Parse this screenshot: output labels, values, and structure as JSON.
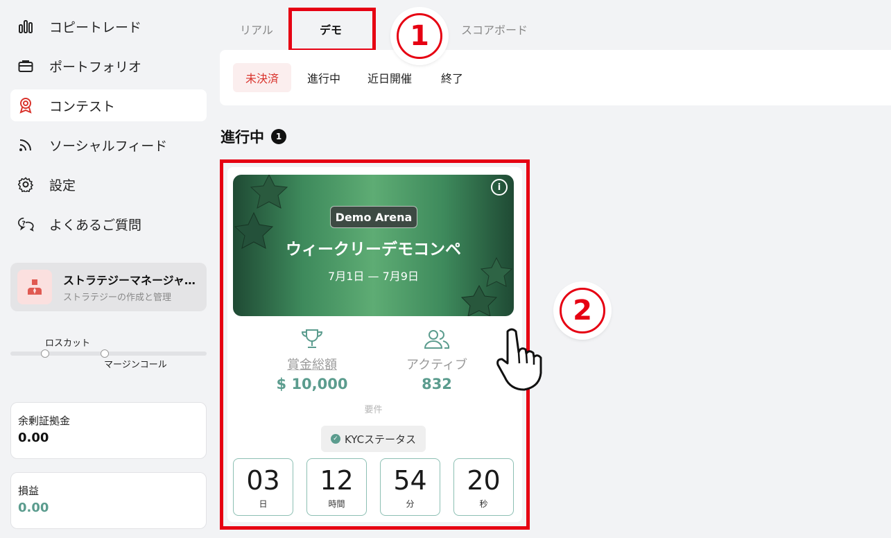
{
  "sidebar": {
    "items": [
      {
        "label": "コピートレード",
        "icon": "bar-chart-icon"
      },
      {
        "label": "ポートフォリオ",
        "icon": "briefcase-icon"
      },
      {
        "label": "コンテスト",
        "icon": "award-ribbon-icon",
        "active": true
      },
      {
        "label": "ソーシャルフィード",
        "icon": "rss-feed-icon"
      },
      {
        "label": "設定",
        "icon": "gear-icon"
      },
      {
        "label": "よくあるご質問",
        "icon": "chat-question-icon"
      }
    ],
    "strategy": {
      "title": "ストラテジーマネージャ…",
      "subtitle": "ストラテジーの作成と管理"
    },
    "slider": {
      "stop_loss_label": "ロスカット",
      "margin_call_label": "マージンコール"
    },
    "free_margin": {
      "label": "余剰証拠金",
      "value": "0.00"
    },
    "pnl": {
      "label": "損益",
      "value": "0.00"
    }
  },
  "top_tabs": [
    "リアル",
    "デモ",
    "スコアボード"
  ],
  "sub_tabs": [
    "未決済",
    "進行中",
    "近日開催",
    "終了"
  ],
  "section": {
    "title": "進行中",
    "count": "1"
  },
  "contest": {
    "badge": "Demo Arena",
    "title": "ウィークリーデモコンペ",
    "dates": "7月1日 — 7月9日",
    "prize_label": "賞金総額",
    "prize_value": "$ 10,000",
    "active_label": "アクティブ",
    "active_value": "832",
    "requirements_label": "要件",
    "kyc_label": "KYCステータス",
    "countdown": [
      {
        "value": "03",
        "unit": "日"
      },
      {
        "value": "12",
        "unit": "時間"
      },
      {
        "value": "54",
        "unit": "分"
      },
      {
        "value": "20",
        "unit": "秒"
      }
    ]
  },
  "annotations": {
    "one": "1",
    "two": "2"
  },
  "colors": {
    "highlight": "#e60012",
    "teal": "#5b9c8e",
    "active_tab_red": "#d9332c"
  }
}
